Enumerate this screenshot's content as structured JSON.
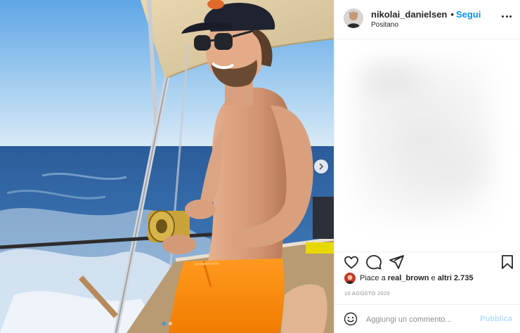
{
  "post": {
    "username": "nikolai_danielsen",
    "follow_label": "Segui",
    "separator": "•",
    "location": "Positano",
    "more_icon": "more-horizontal-icon",
    "photo_icon": "fishing-boat-photo"
  },
  "actions": {
    "icons": [
      "heart-icon",
      "comment-icon",
      "share-icon",
      "bookmark-icon"
    ]
  },
  "likes": {
    "prefix": "Piace a",
    "user": "real_brown",
    "conjunction": "e",
    "others": "altri 2.735"
  },
  "date": "10 AGOSTO 2020",
  "comment_box": {
    "placeholder": "Aggiungi un commento...",
    "submit_label": "Pubblica"
  },
  "carousel": {
    "slide_count": 2,
    "active_index": 0
  },
  "colors": {
    "link": "#0095f6",
    "submit_disabled": "#b2dffc",
    "text": "#262626",
    "muted": "#8e8e8e",
    "carousel_active": "#3897f0"
  }
}
